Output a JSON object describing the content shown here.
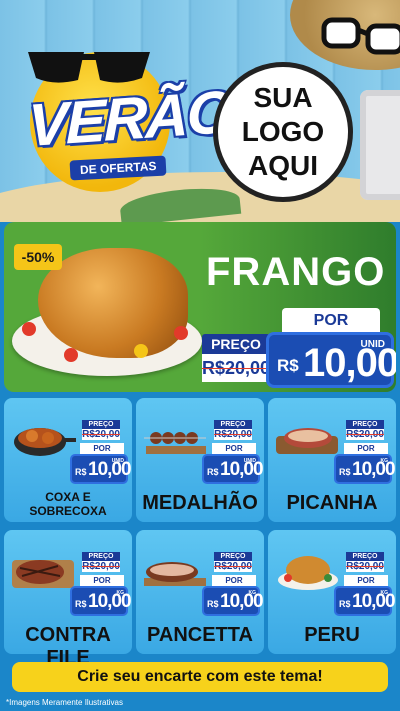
{
  "header": {
    "title_main": "VERÃO",
    "title_sub": "DE OFERTAS",
    "logo_line1": "SUA",
    "logo_line2": "LOGO",
    "logo_line3": "AQUI"
  },
  "featured": {
    "name": "FRANGO",
    "discount": "-50%",
    "preco_label": "PREÇO",
    "old_price": "R$20,00",
    "por_label": "POR",
    "currency": "R$",
    "price": "10,00",
    "unit": "UNID"
  },
  "products": [
    {
      "name": "COXA E SOBRECOXA",
      "preco_label": "PREÇO",
      "old_price": "R$20,00",
      "por_label": "POR",
      "currency": "R$",
      "price": "10,00",
      "unit": "UNID"
    },
    {
      "name": "MEDALHÃO",
      "preco_label": "PREÇO",
      "old_price": "R$20,00",
      "por_label": "POR",
      "currency": "R$",
      "price": "10,00",
      "unit": "UNID"
    },
    {
      "name": "PICANHA",
      "preco_label": "PREÇO",
      "old_price": "R$20,00",
      "por_label": "POR",
      "currency": "R$",
      "price": "10,00",
      "unit": "KG"
    },
    {
      "name": "CONTRA FILE",
      "preco_label": "PREÇO",
      "old_price": "R$20,00",
      "por_label": "POR",
      "currency": "R$",
      "price": "10,00",
      "unit": "KG"
    },
    {
      "name": "PANCETTA",
      "preco_label": "PREÇO",
      "old_price": "R$20,00",
      "por_label": "POR",
      "currency": "R$",
      "price": "10,00",
      "unit": "KG"
    },
    {
      "name": "PERU",
      "preco_label": "PREÇO",
      "old_price": "R$20,00",
      "por_label": "POR",
      "currency": "R$",
      "price": "10,00",
      "unit": "KG"
    }
  ],
  "footer": {
    "cta": "Crie seu encarte com este tema!",
    "disclaimer": "*Imagens Meramente Ilustrativas"
  },
  "colors": {
    "header_bg": "#7cc2e6",
    "featured_green": "#55a83a",
    "price_blue": "#1b4db3",
    "label_navy": "#1b3a97",
    "card_blue": "#3aa8e4",
    "cta_yellow": "#f7d21b",
    "discount_yellow": "#f5c518"
  },
  "icons": [
    "sunglasses-icon",
    "sun-icon",
    "hat-icon",
    "chicken-image",
    "drumstick-image",
    "skewer-image",
    "picanha-image",
    "steak-image",
    "pancetta-image",
    "turkey-image"
  ]
}
